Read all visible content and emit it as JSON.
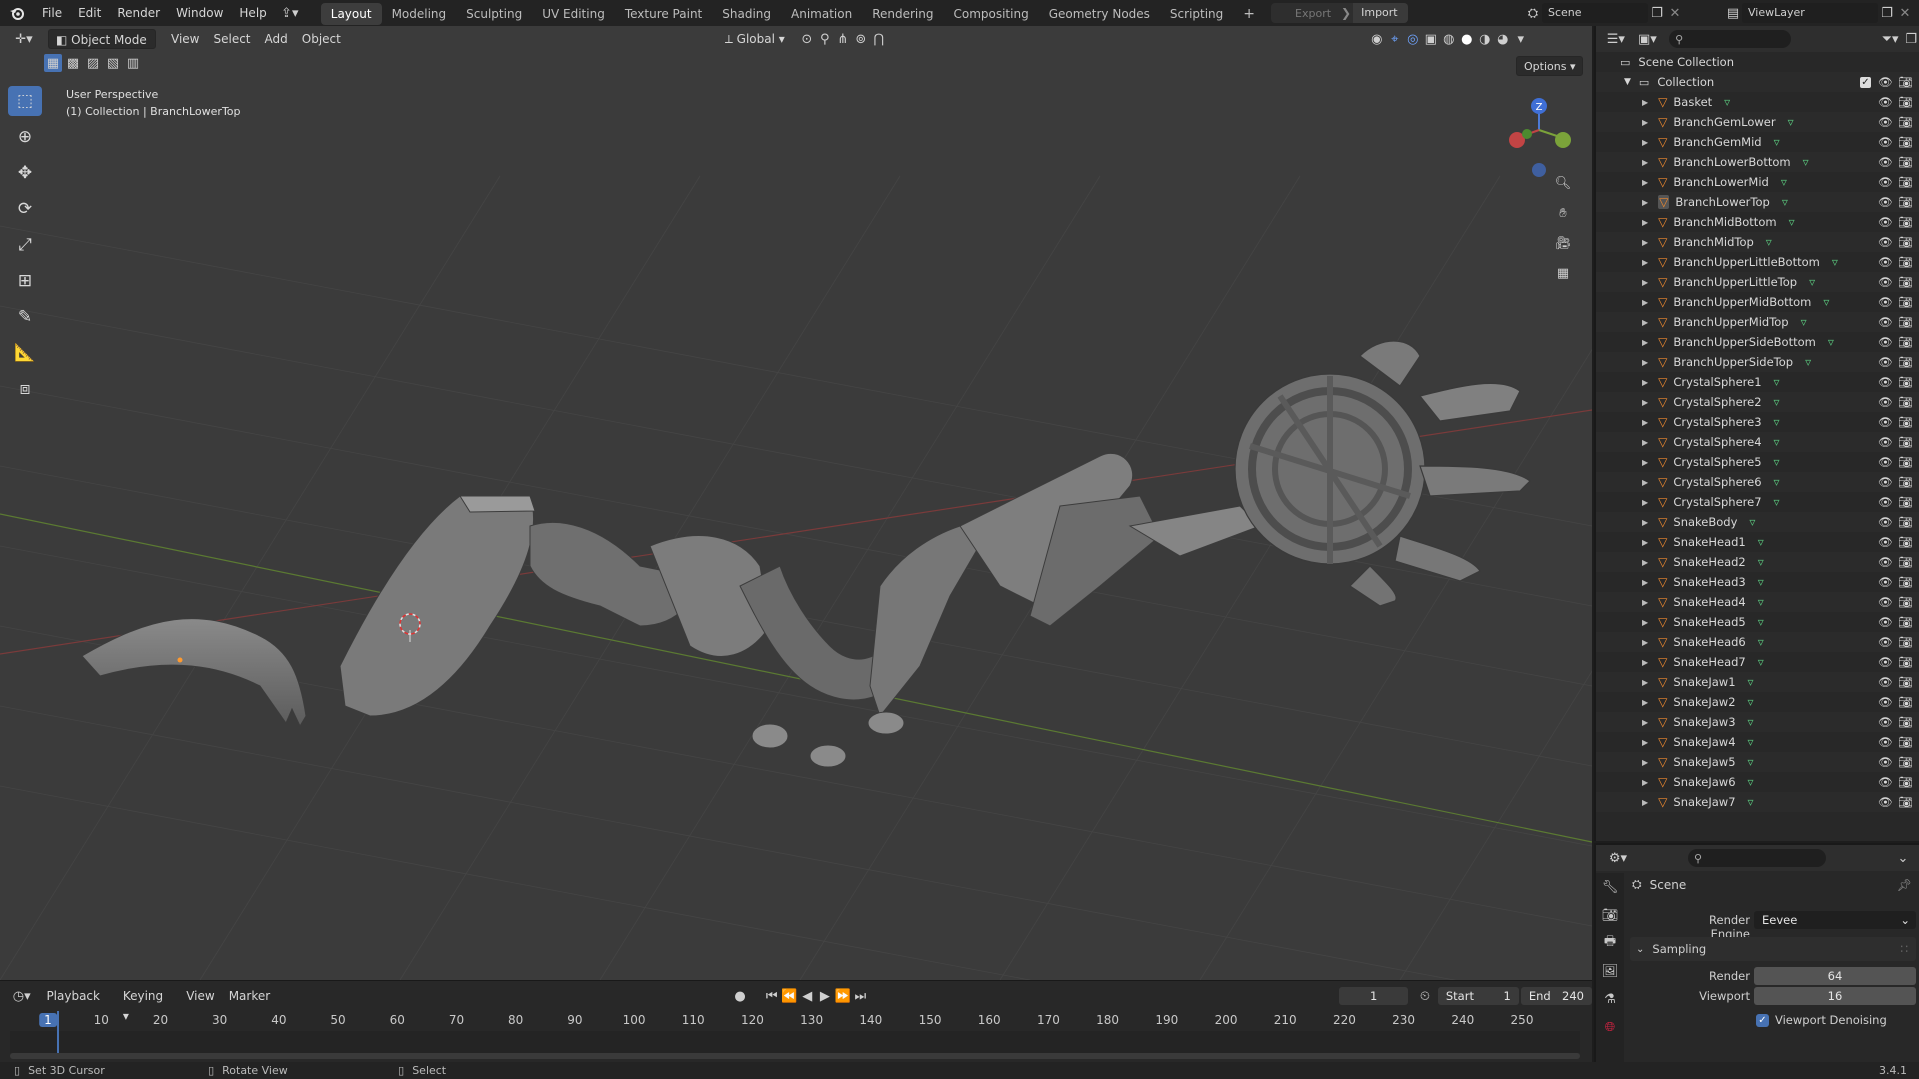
{
  "topbar": {
    "menus": [
      "File",
      "Edit",
      "Render",
      "Window",
      "Help"
    ],
    "workspaces": [
      "Layout",
      "Modeling",
      "Sculpting",
      "UV Editing",
      "Texture Paint",
      "Shading",
      "Animation",
      "Rendering",
      "Compositing",
      "Geometry Nodes",
      "Scripting"
    ],
    "active_workspace": "Layout",
    "add_workspace": "+",
    "export_label": "Export",
    "import_label": "Import",
    "scene_name": "Scene",
    "view_layer": "ViewLayer"
  },
  "viewport": {
    "mode": "Object Mode",
    "menus": [
      "View",
      "Select",
      "Add",
      "Object"
    ],
    "transform_orientation": "Global",
    "options_label": "Options",
    "perspective_text": "User Perspective",
    "collection_text": "(1) Collection | BranchLowerTop",
    "gizmo_axes": {
      "z": "Z"
    },
    "accent": "#4772b3"
  },
  "timeline": {
    "menus": [
      "Playback",
      "Keying",
      "View",
      "Marker"
    ],
    "current_frame": "1",
    "start_label": "Start",
    "start_value": "1",
    "end_label": "End",
    "end_value": "240",
    "ticks": [
      "1",
      "10",
      "20",
      "30",
      "40",
      "50",
      "60",
      "70",
      "80",
      "90",
      "100",
      "110",
      "120",
      "130",
      "140",
      "150",
      "160",
      "170",
      "180",
      "190",
      "200",
      "210",
      "220",
      "230",
      "240",
      "250"
    ]
  },
  "statusbar": {
    "hint1": "Set 3D Cursor",
    "hint2": "Rotate View",
    "hint3": "Select",
    "version": "3.4.1"
  },
  "outliner": {
    "scene_collection": "Scene Collection",
    "collection": "Collection",
    "selected": "BranchLowerTop",
    "items": [
      "Basket",
      "BranchGemLower",
      "BranchGemMid",
      "BranchLowerBottom",
      "BranchLowerMid",
      "BranchLowerTop",
      "BranchMidBottom",
      "BranchMidTop",
      "BranchUpperLittleBottom",
      "BranchUpperLittleTop",
      "BranchUpperMidBottom",
      "BranchUpperMidTop",
      "BranchUpperSideBottom",
      "BranchUpperSideTop",
      "CrystalSphere1",
      "CrystalSphere2",
      "CrystalSphere3",
      "CrystalSphere4",
      "CrystalSphere5",
      "CrystalSphere6",
      "CrystalSphere7",
      "SnakeBody",
      "SnakeHead1",
      "SnakeHead2",
      "SnakeHead3",
      "SnakeHead4",
      "SnakeHead5",
      "SnakeHead6",
      "SnakeHead7",
      "SnakeJaw1",
      "SnakeJaw2",
      "SnakeJaw3",
      "SnakeJaw4",
      "SnakeJaw5",
      "SnakeJaw6",
      "SnakeJaw7"
    ]
  },
  "properties": {
    "context": "Scene",
    "render_engine_label": "Render Engine",
    "render_engine_value": "Eevee",
    "sampling_label": "Sampling",
    "render_label": "Render",
    "render_value": "64",
    "viewport_label": "Viewport",
    "viewport_value": "16",
    "denoise_label": "Viewport Denoising"
  }
}
